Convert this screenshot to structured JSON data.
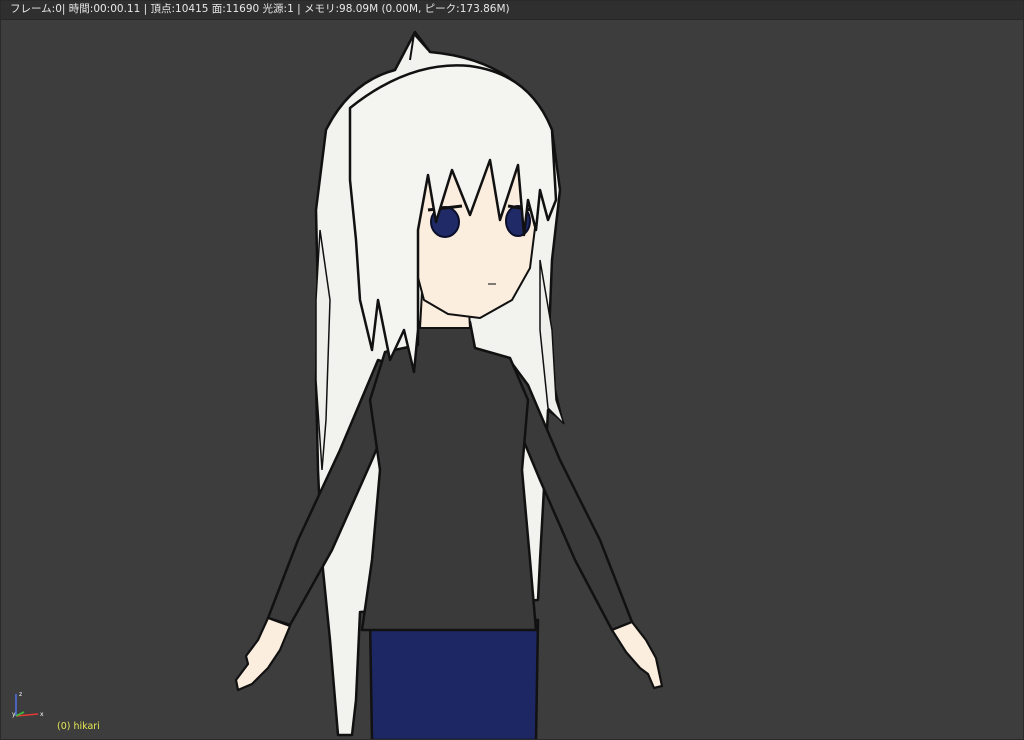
{
  "viewport": {
    "stats_text": "フレーム:0| 時間:00:00.11 | 頂点:10415 面:11690 光源:1 | メモリ:98.09M (0.00M,  ピーク:173.86M)",
    "object_label": "(0) hikari",
    "background_color": "#3d3d3d",
    "label_color": "#e6e655",
    "axis_colors": {
      "x": "#e53935",
      "y": "#3fbf3f",
      "z": "#4d6ee0"
    },
    "axis_letters": {
      "x": "x",
      "y": "y",
      "z": "z"
    }
  },
  "character": {
    "hair_color": "#f2f2ef",
    "skin_color": "#fbeede",
    "shirt_color": "#3a3a3a",
    "pants_color": "#1d2763",
    "eye_color": "#1f2a66"
  }
}
